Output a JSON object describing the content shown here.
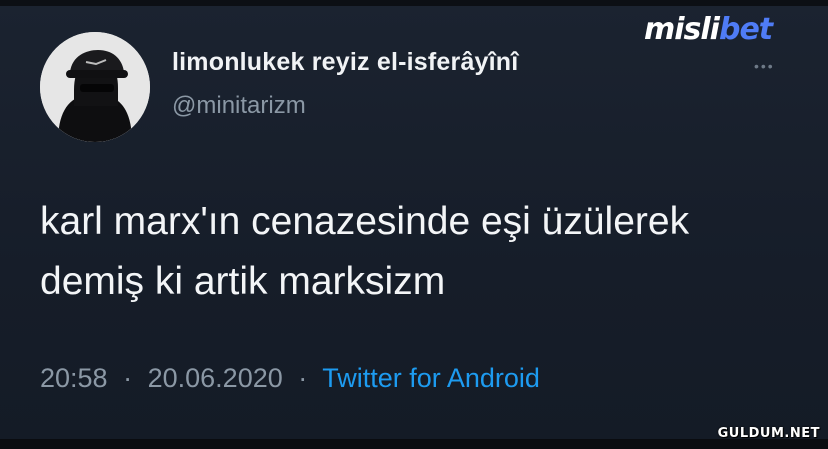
{
  "brand": {
    "part_a": "misli",
    "part_b": "bet",
    "colors": {
      "part_a": "#ffffff",
      "part_b": "#4f7cf6"
    }
  },
  "tweet": {
    "display_name": "limonlukek reyiz el-isferâyînî",
    "handle": "@minitarizm",
    "more_icon": "more-horizontal-icon",
    "avatar_icon": "avatar-icon",
    "text_lines": [
      "karl marx'ın cenazesinde eşi üzülerek",
      "demiş ki artik marksizm"
    ],
    "time": "20:58",
    "separator": "·",
    "date": "20.06.2020",
    "source": "Twitter for Android"
  },
  "watermark": "GULDUM.NET",
  "colors": {
    "background": "#161d29",
    "text_primary": "#f1f3f5",
    "text_secondary": "#8b98a5",
    "link": "#1d9bf0"
  }
}
